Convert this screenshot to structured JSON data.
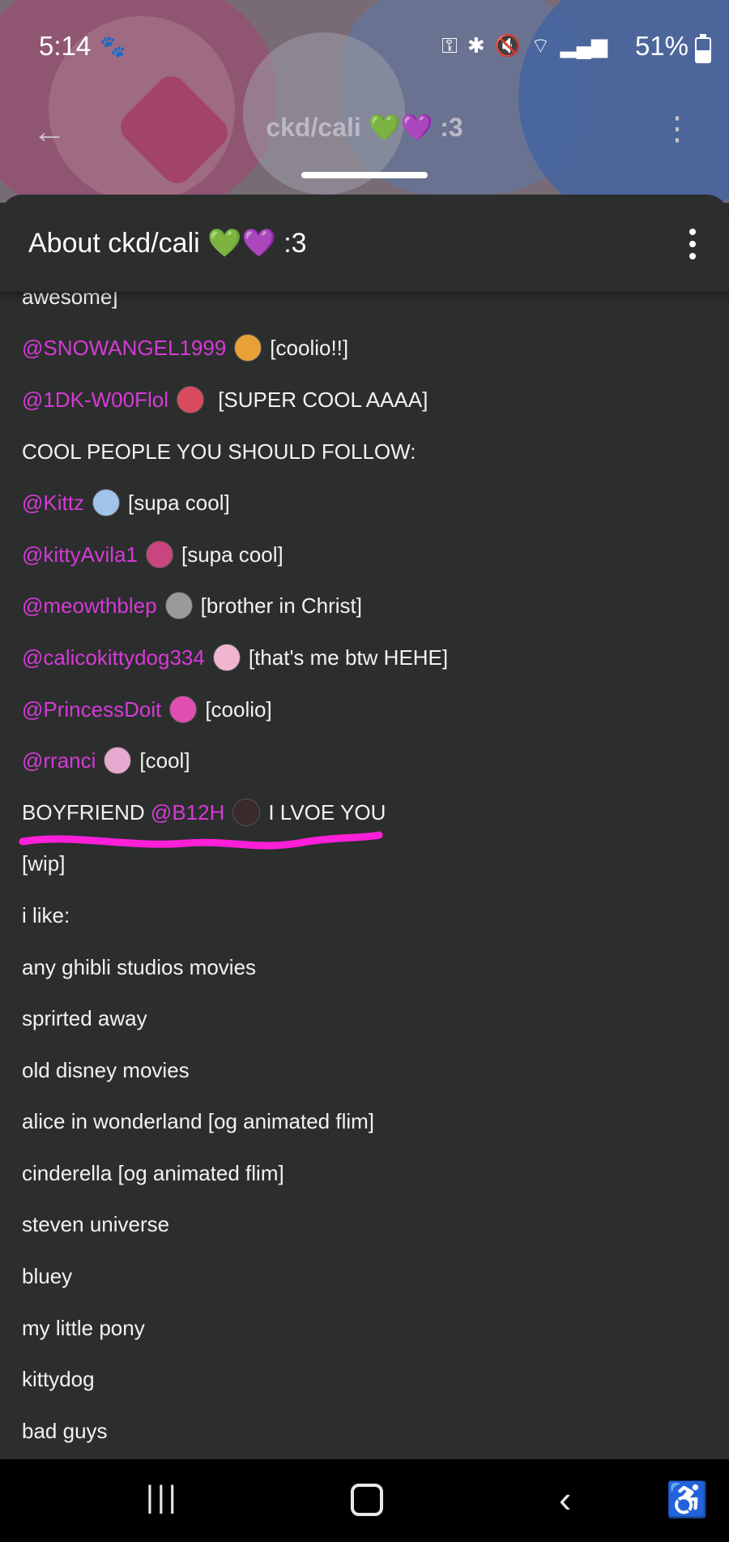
{
  "status_bar": {
    "time": "5:14",
    "battery_percent": "51%",
    "battery_level": 0.51
  },
  "app_bar": {
    "title": "ckd/cali 💚💜 :3"
  },
  "sheet": {
    "title": "About ckd/cali 💚💜 :3"
  },
  "lines": [
    {
      "segments": [
        {
          "text": "awesome]"
        }
      ]
    },
    {
      "segments": [
        {
          "text": "@SNOWANGEL1999",
          "mention": true
        },
        {
          "avatar": "#e8a137"
        },
        {
          "text": "[coolio!!]"
        }
      ]
    },
    {
      "segments": [
        {
          "text": "@1DK-W00Flol",
          "mention": true
        },
        {
          "avatar": "#d94a5f"
        },
        {
          "text": " [SUPER COOL AAAA]"
        }
      ]
    },
    {
      "segments": [
        {
          "text": "COOL PEOPLE YOU SHOULD FOLLOW:"
        }
      ]
    },
    {
      "segments": [
        {
          "text": "@Kittz",
          "mention": true
        },
        {
          "avatar": "#9fc3ea"
        },
        {
          "text": "[supa cool]"
        }
      ]
    },
    {
      "segments": [
        {
          "text": "@kittyAvila1",
          "mention": true
        },
        {
          "avatar": "#c9457d"
        },
        {
          "text": "[supa cool]"
        }
      ]
    },
    {
      "segments": [
        {
          "text": "@meowthblep",
          "mention": true
        },
        {
          "avatar": "#9a9a9a"
        },
        {
          "text": "[brother in Christ]"
        }
      ]
    },
    {
      "segments": [
        {
          "text": "@calicokittydog334",
          "mention": true
        },
        {
          "avatar": "#f0b6d0"
        },
        {
          "text": "[that's me btw HEHE]"
        }
      ]
    },
    {
      "segments": [
        {
          "text": "@PrincessDoit",
          "mention": true
        },
        {
          "avatar": "#e04fb0"
        },
        {
          "text": "[coolio]"
        }
      ]
    },
    {
      "segments": [
        {
          "text": "@rranci",
          "mention": true
        },
        {
          "avatar": "#e6a9cf"
        },
        {
          "text": "[cool]"
        }
      ]
    },
    {
      "segments": [
        {
          "text": "BOYFRIEND "
        },
        {
          "text": "@B12H",
          "mention": true
        },
        {
          "avatar": "#3a2a2a"
        },
        {
          "text": "I LVOE YOU"
        }
      ]
    },
    {
      "segments": [
        {
          "text": "[wip]"
        }
      ]
    },
    {
      "segments": [
        {
          "text": "i like:"
        }
      ]
    },
    {
      "segments": [
        {
          "text": "any ghibli studios movies"
        }
      ]
    },
    {
      "segments": [
        {
          "text": "sprirted away"
        }
      ]
    },
    {
      "segments": [
        {
          "text": "old disney movies"
        }
      ]
    },
    {
      "segments": [
        {
          "text": "alice in wonderland [og animated flim]"
        }
      ]
    },
    {
      "segments": [
        {
          "text": "cinderella [og animated flim]"
        }
      ]
    },
    {
      "segments": [
        {
          "text": "steven universe"
        }
      ]
    },
    {
      "segments": [
        {
          "text": "bluey"
        }
      ]
    },
    {
      "segments": [
        {
          "text": "my little pony"
        }
      ]
    },
    {
      "segments": [
        {
          "text": "kittydog"
        }
      ]
    },
    {
      "segments": [
        {
          "text": "bad guys"
        }
      ]
    }
  ],
  "colors": {
    "mention": "#d63ad6",
    "background": "#2b2e2d",
    "underline": "#ff1fd9"
  },
  "icons": {
    "status": [
      "paw-icon",
      "key-icon",
      "bluetooth-icon",
      "mute-icon",
      "wifi-icon",
      "signal-icon",
      "battery-icon"
    ],
    "nav": [
      "recent-apps-icon",
      "home-icon",
      "back-icon",
      "accessibility-icon"
    ]
  }
}
